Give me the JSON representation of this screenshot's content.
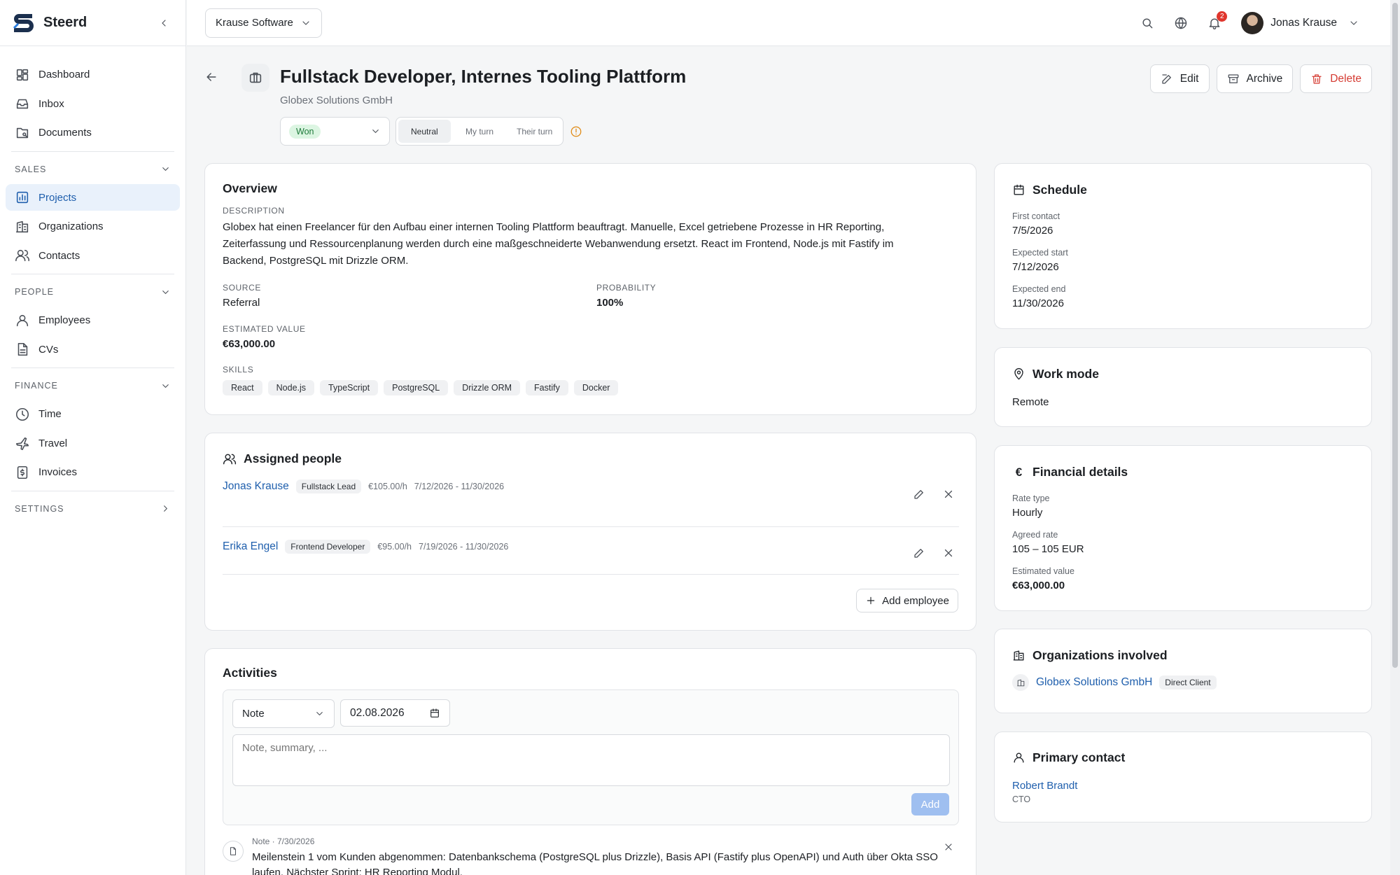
{
  "app": {
    "name": "Steerd"
  },
  "sidebar": {
    "main": [
      {
        "label": "Dashboard",
        "icon": "dashboard-icon"
      },
      {
        "label": "Inbox",
        "icon": "inbox-icon"
      },
      {
        "label": "Documents",
        "icon": "documents-icon"
      }
    ],
    "sales_label": "SALES",
    "sales": [
      {
        "label": "Projects",
        "icon": "projects-icon",
        "active": true
      },
      {
        "label": "Organizations",
        "icon": "building-icon"
      },
      {
        "label": "Contacts",
        "icon": "contacts-icon"
      }
    ],
    "people_label": "PEOPLE",
    "people": [
      {
        "label": "Employees",
        "icon": "employees-icon"
      },
      {
        "label": "CVs",
        "icon": "cv-icon"
      }
    ],
    "finance_label": "FINANCE",
    "finance": [
      {
        "label": "Time",
        "icon": "clock-icon"
      },
      {
        "label": "Travel",
        "icon": "plane-icon"
      },
      {
        "label": "Invoices",
        "icon": "invoice-icon"
      }
    ],
    "settings_label": "SETTINGS"
  },
  "topbar": {
    "org": "Krause Software",
    "notification_count": "2",
    "user_name": "Jonas Krause"
  },
  "project": {
    "title": "Fullstack Developer, Internes Tooling Plattform",
    "company": "Globex Solutions GmbH",
    "status": "Won",
    "turn_options": [
      "Neutral",
      "My turn",
      "Their turn"
    ],
    "turn_selected": "Neutral"
  },
  "actions": {
    "edit": "Edit",
    "archive": "Archive",
    "delete": "Delete"
  },
  "overview": {
    "title": "Overview",
    "description_label": "DESCRIPTION",
    "description": "Globex hat einen Freelancer für den Aufbau einer internen Tooling Plattform beauftragt. Manuelle, Excel getriebene Prozesse in HR Reporting, Zeiterfassung und Ressourcenplanung werden durch eine maßgeschneiderte Webanwendung ersetzt. React im Frontend, Node.js mit Fastify im Backend, PostgreSQL mit Drizzle ORM.",
    "source_label": "SOURCE",
    "source": "Referral",
    "probability_label": "PROBABILITY",
    "probability": "100%",
    "value_label": "ESTIMATED VALUE",
    "value": "€63,000.00",
    "skills_label": "SKILLS",
    "skills": [
      "React",
      "Node.js",
      "TypeScript",
      "PostgreSQL",
      "Drizzle ORM",
      "Fastify",
      "Docker"
    ]
  },
  "assigned": {
    "title": "Assigned people",
    "people": [
      {
        "name": "Jonas Krause",
        "role": "Fullstack Lead",
        "rate": "€105.00/h",
        "dates": "7/12/2026 - 11/30/2026"
      },
      {
        "name": "Erika Engel",
        "role": "Frontend Developer",
        "rate": "€95.00/h",
        "dates": "7/19/2026 - 11/30/2026"
      }
    ],
    "add_label": "Add employee"
  },
  "activities": {
    "title": "Activities",
    "type": "Note",
    "date": "02.08.2026",
    "placeholder": "Note, summary, ...",
    "add_label": "Add",
    "items": [
      {
        "meta": "Note · 7/30/2026",
        "text": "Meilenstein 1 vom Kunden abgenommen: Datenbankschema (PostgreSQL plus Drizzle), Basis API (Fastify plus OpenAPI) und Auth über Okta SSO laufen. Nächster Sprint: HR Reporting Modul."
      }
    ]
  },
  "schedule": {
    "title": "Schedule",
    "first_contact_label": "First contact",
    "first_contact": "7/5/2026",
    "start_label": "Expected start",
    "start": "7/12/2026",
    "end_label": "Expected end",
    "end": "11/30/2026"
  },
  "work_mode": {
    "title": "Work mode",
    "value": "Remote"
  },
  "financial": {
    "title": "Financial details",
    "rate_type_label": "Rate type",
    "rate_type": "Hourly",
    "agreed_label": "Agreed rate",
    "agreed": "105 – 105 EUR",
    "value_label": "Estimated value",
    "value": "€63,000.00"
  },
  "orgs": {
    "title": "Organizations involved",
    "name": "Globex Solutions GmbH",
    "role": "Direct Client"
  },
  "primary_contact": {
    "title": "Primary contact",
    "name": "Robert Brandt",
    "role": "CTO"
  },
  "colors": {
    "accent": "#1f5fad",
    "danger": "#d53b32",
    "won": "#1d7a3a",
    "warning": "#e08a14"
  }
}
